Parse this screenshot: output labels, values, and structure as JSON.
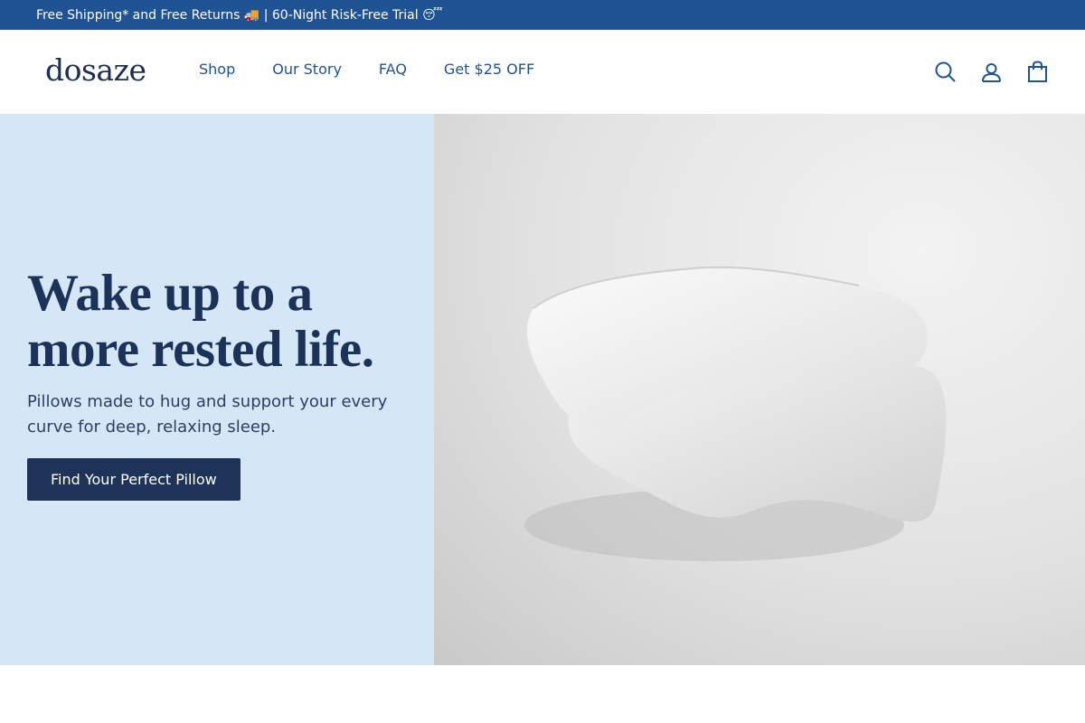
{
  "announcement": {
    "text": "Free Shipping* and Free Returns 🚚 | 60-Night Risk-Free Trial 😴"
  },
  "header": {
    "logo_text": "dosaze",
    "nav": [
      {
        "label": "Shop"
      },
      {
        "label": "Our Story"
      },
      {
        "label": "FAQ"
      },
      {
        "label": "Get $25 OFF"
      }
    ],
    "icons": [
      "search-icon",
      "account-icon",
      "cart-icon"
    ]
  },
  "hero": {
    "title": "Wake up to a more rested life.",
    "subtitle": "Pillows made to hug and support your every curve for deep, relaxing sleep.",
    "cta_label": "Find Your Perfect Pillow",
    "image_alt": "two-contour-memory-foam-pillows"
  },
  "colors": {
    "announcement_bg": "#1f5394",
    "nav_text": "#1f5394",
    "hero_left_bg": "#d5e7f6",
    "cta_bg": "#1e3358",
    "title_text": "#1c3359"
  }
}
